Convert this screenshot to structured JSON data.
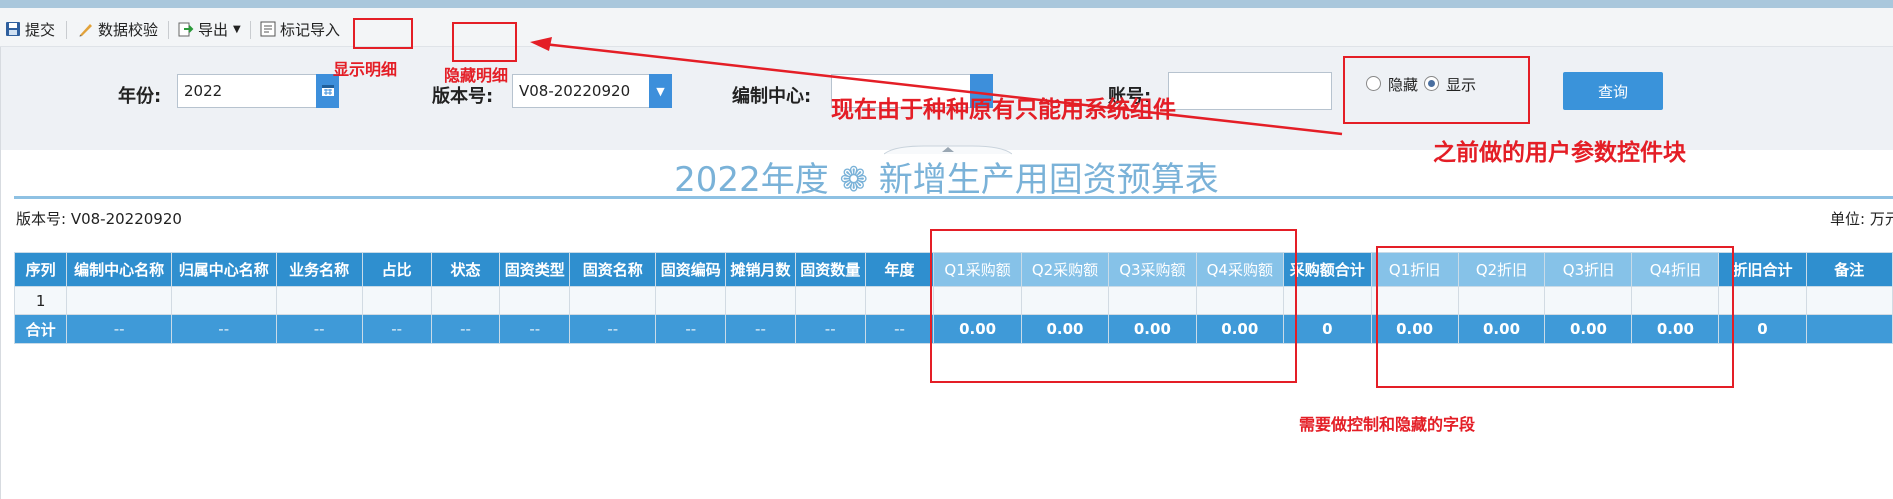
{
  "toolbar": {
    "items": [
      {
        "label": "提交",
        "icon": "save-icon"
      },
      {
        "label": "数据校验",
        "icon": "check-pencil-icon"
      },
      {
        "label": "导出",
        "icon": "export-icon"
      },
      {
        "label": "标记导入",
        "icon": "import-icon"
      }
    ]
  },
  "filters": {
    "year_label": "年份:",
    "year_value": "2022",
    "version_label": "版本号:",
    "version_value": "V08-20220920",
    "center_label": "编制中心:",
    "center_value": "",
    "account_label": "账号:",
    "account_value": "",
    "radio_hide": "隐藏",
    "radio_show": "显示",
    "radio_selected": "显示",
    "query_button": "查询"
  },
  "report": {
    "title": "2022年度 ❁ 新增生产用固资预算表",
    "version_text": "版本号: V08-20220920",
    "unit_text": "单位: 万元"
  },
  "table": {
    "columns": [
      "序列",
      "编制中心名称",
      "归属中心名称",
      "业务名称",
      "占比",
      "状态",
      "固资类型",
      "固资名称",
      "固资编码",
      "摊销月数",
      "固资数量",
      "年度",
      "Q1采购额",
      "Q2采购额",
      "Q3采购额",
      "Q4采购额",
      "采购额合计",
      "Q1折旧",
      "Q2折旧",
      "Q3折旧",
      "Q4折旧",
      "折旧合计",
      "备注"
    ],
    "rows": [
      [
        "1",
        "",
        "",
        "",
        "",
        "",
        "",
        "",
        "",
        "",
        "",
        "",
        "",
        "",
        "",
        "",
        "",
        "",
        "",
        "",
        "",
        "",
        ""
      ]
    ],
    "summary": [
      "合计",
      "--",
      "--",
      "--",
      "--",
      "--",
      "--",
      "--",
      "--",
      "--",
      "--",
      "--",
      "0.00",
      "0.00",
      "0.00",
      "0.00",
      "0",
      "0.00",
      "0.00",
      "0.00",
      "0.00",
      "0",
      ""
    ]
  },
  "annotations": {
    "show_detail": "显示明细",
    "hide_detail": "隐藏明细",
    "note_system": "现在由于种种原有只能用系统组件",
    "note_previous": "之前做的用户参数控件块",
    "note_fields": "需要做控制和隐藏的字段"
  },
  "colors": {
    "header_blue": "#2f8fcf",
    "header_light_blue": "#86c2e8",
    "annotation_red": "#e41e26",
    "title_blue": "#7ab2d8"
  }
}
